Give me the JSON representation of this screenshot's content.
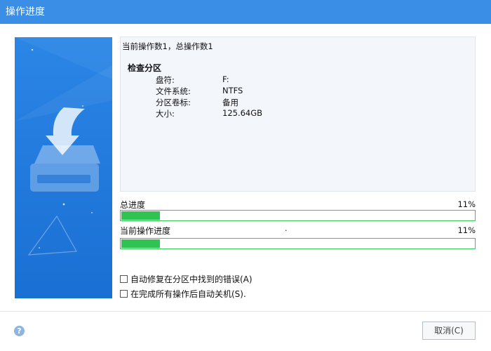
{
  "window": {
    "title": "操作进度"
  },
  "info": {
    "current_op_text": "当前操作数1，总操作数1",
    "heading": "检查分区",
    "rows": [
      {
        "label": "盘符:",
        "value": "F:"
      },
      {
        "label": "文件系统:",
        "value": "NTFS"
      },
      {
        "label": "分区卷标:",
        "value": "备用"
      },
      {
        "label": "大小:",
        "value": "125.64GB"
      }
    ]
  },
  "progress": {
    "total": {
      "label": "总进度",
      "percent_text": "11%",
      "fraction": 0.11
    },
    "current": {
      "label": "当前操作进度",
      "mark": ".",
      "percent_text": "11%",
      "fraction": 0.11
    }
  },
  "options": {
    "auto_fix": "自动修复在分区中找到的错误(A)",
    "auto_shutdown": "在完成所有操作后自动关机(S)."
  },
  "footer": {
    "cancel_label": "取消(C)",
    "help_icon": "question-circle-icon"
  },
  "colors": {
    "titlebar": "#3a8ee6",
    "progress_fill": "#2fc451",
    "side_panel": "#2b86e6"
  }
}
